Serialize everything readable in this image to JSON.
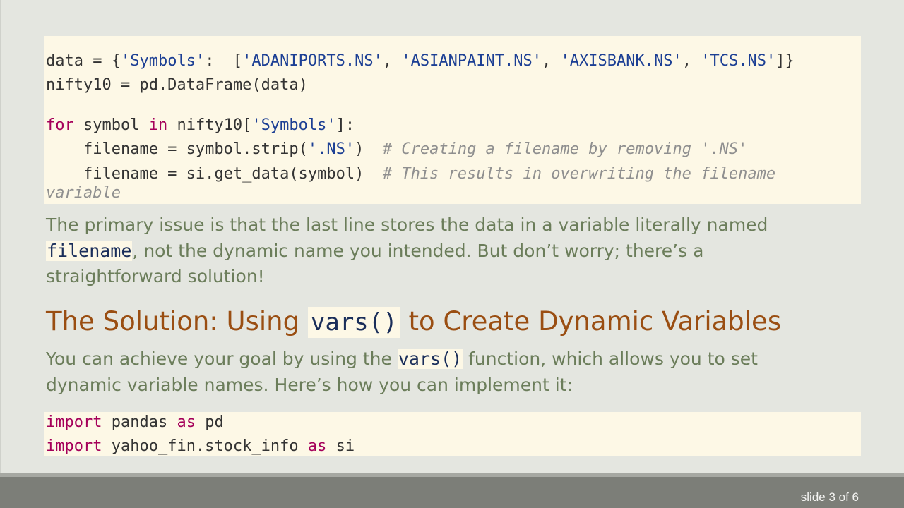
{
  "code_top": {
    "line1": {
      "p1": "data = {",
      "p2": "'Symbols'",
      "p3": ":  [",
      "p4": "'ADANIPORTS.NS'",
      "p5": ", ",
      "p6": "'ASIANPAINT.NS'",
      "p7": ", ",
      "p8": "'AXISBANK.NS'",
      "p9": ", ",
      "p10": "'TCS.NS'",
      "p11": "]}"
    },
    "line2": "nifty10 = pd.DataFrame(data)",
    "line3": {
      "kw1": "for",
      "p1": " symbol ",
      "kw2": "in",
      "p2": " nifty10[",
      "s1": "'Symbols'",
      "p3": "]:"
    },
    "line4": {
      "p1": "    filename = symbol.strip(",
      "s1": "'.NS'",
      "p2": ")  ",
      "c1": "# Creating a filename by removing '.NS'"
    },
    "line5": {
      "p1": "    filename = si.get_data(symbol)  ",
      "c1": "# This results in overwriting the filename"
    },
    "line6": {
      "c1": "variable"
    }
  },
  "paragraph1": {
    "text1": "The primary issue is that the last line stores the data in a variable literally named",
    "code1": "filename",
    "text2": ", not the dynamic name you intended. But don’t worry; there’s a",
    "text3": "straightforward solution!"
  },
  "heading": {
    "text1": "The Solution: Using ",
    "code1": "vars()",
    "text2": " to Create Dynamic Variables"
  },
  "paragraph2": {
    "text1": "You can achieve your goal by using the ",
    "code1": "vars()",
    "text2": " function, which allows you to set",
    "text3": "dynamic variable names. Here’s how you can implement it:"
  },
  "code_bottom": {
    "line1": {
      "kw1": "import",
      "p1": " pandas ",
      "kw2": "as",
      "p2": " pd"
    },
    "line2": {
      "kw1": "import",
      "p1": " yahoo_fin.stock_info ",
      "kw2": "as",
      "p2": " si"
    }
  },
  "footer": {
    "slide_counter": "slide 3 of 6"
  },
  "colors": {
    "background": "#e4e6e0",
    "code_background": "#fdf8e6",
    "keyword": "#a5005a",
    "string": "#1c3f94",
    "comment": "#8f8f8f",
    "prose_text": "#6b7d5a",
    "heading_text": "#9a4e12",
    "footer_bar": "#7c7e78"
  }
}
